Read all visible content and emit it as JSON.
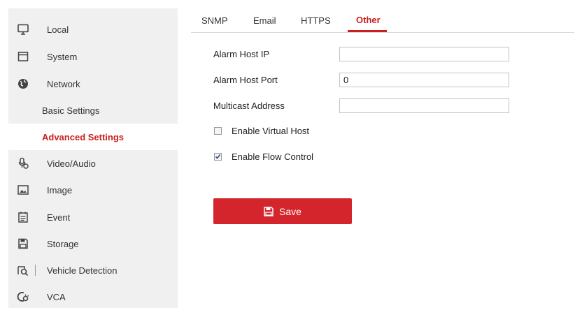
{
  "sidebar": {
    "items": [
      {
        "label": "Local",
        "icon": "monitor-icon"
      },
      {
        "label": "System",
        "icon": "system-icon"
      },
      {
        "label": "Network",
        "icon": "globe-icon"
      },
      {
        "label": "Basic Settings"
      },
      {
        "label": "Advanced Settings",
        "active": true
      },
      {
        "label": "Video/Audio",
        "icon": "video-audio-icon"
      },
      {
        "label": "Image",
        "icon": "image-icon"
      },
      {
        "label": "Event",
        "icon": "event-icon"
      },
      {
        "label": "Storage",
        "icon": "storage-icon"
      },
      {
        "label": "Vehicle Detection",
        "icon": "vehicle-detection-icon"
      },
      {
        "label": "VCA",
        "icon": "vca-icon"
      }
    ]
  },
  "tabs": [
    {
      "label": "SNMP"
    },
    {
      "label": "Email"
    },
    {
      "label": "HTTPS"
    },
    {
      "label": "Other",
      "active": true
    }
  ],
  "form": {
    "alarm_host_ip": {
      "label": "Alarm Host IP",
      "value": ""
    },
    "alarm_host_port": {
      "label": "Alarm Host Port",
      "value": "0"
    },
    "multicast_address": {
      "label": "Multicast Address",
      "value": ""
    },
    "enable_virtual_host": {
      "label": "Enable Virtual Host",
      "checked": false
    },
    "enable_flow_control": {
      "label": "Enable Flow Control",
      "checked": true
    }
  },
  "save_button": {
    "label": "Save"
  },
  "colors": {
    "accent": "#cc1f1f",
    "button": "#d3252b",
    "sidebar_bg": "#f0f0f0"
  }
}
